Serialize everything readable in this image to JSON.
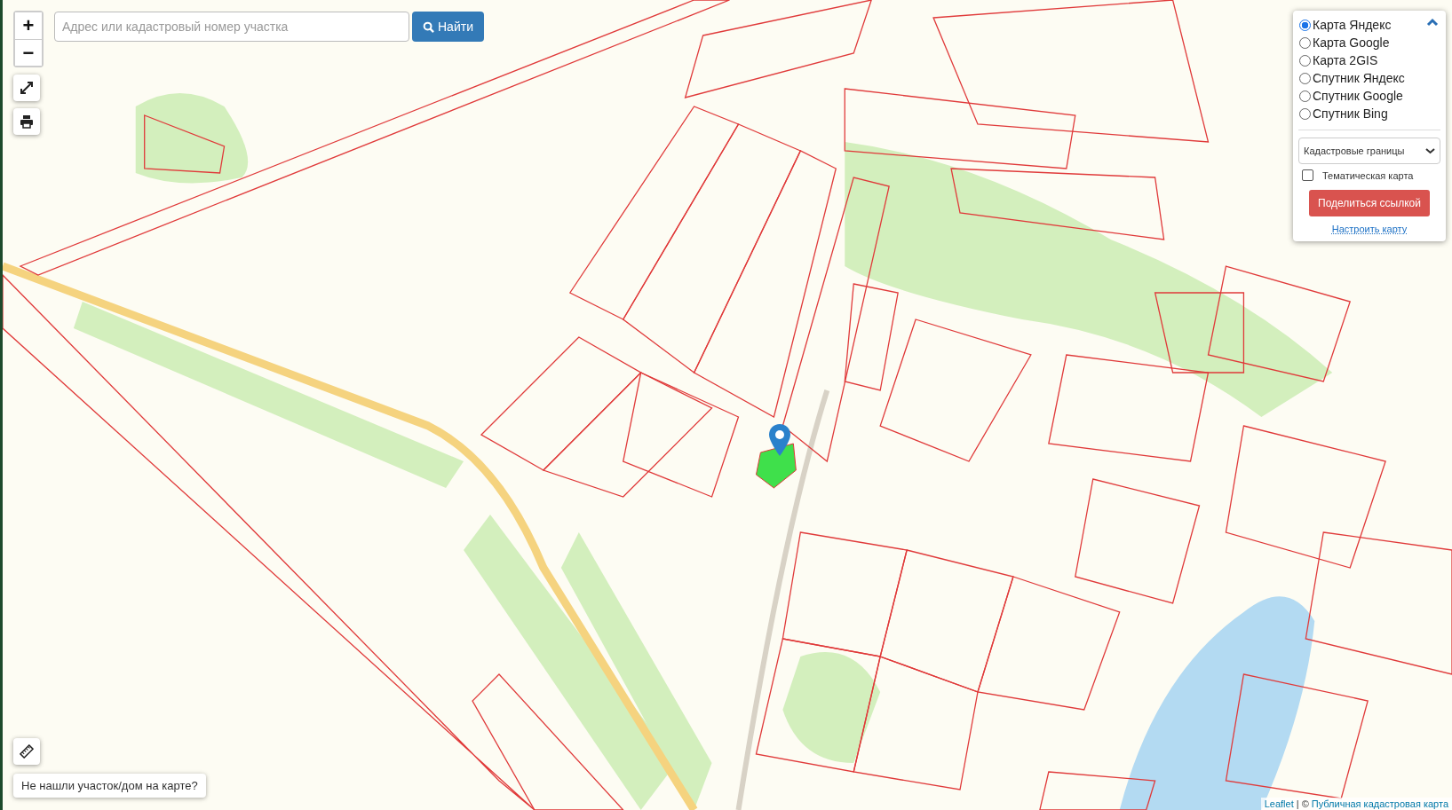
{
  "zoom": {
    "in": "+",
    "out": "−"
  },
  "search": {
    "placeholder": "Адрес или кадастровый номер участка",
    "button": "Найти"
  },
  "layers": {
    "expanded": true,
    "options": [
      {
        "label": "Карта Яндекс",
        "selected": true
      },
      {
        "label": "Карта Google",
        "selected": false
      },
      {
        "label": "Карта 2GIS",
        "selected": false
      },
      {
        "label": "Спутник Яндекс",
        "selected": false
      },
      {
        "label": "Спутник Google",
        "selected": false
      },
      {
        "label": "Спутник Bing",
        "selected": false
      }
    ],
    "overlay_select": "Кадастровые границы",
    "thematic": {
      "label": "Тематическая карта",
      "checked": false
    },
    "share_button": "Поделиться ссылкой",
    "settings_link": "Настроить карту"
  },
  "not_found_button": "Не нашли участок/дом на карте?",
  "attribution": {
    "leaflet": "Leaflet",
    "separator": "| ©",
    "source": "Публичная кадастровая карта"
  }
}
